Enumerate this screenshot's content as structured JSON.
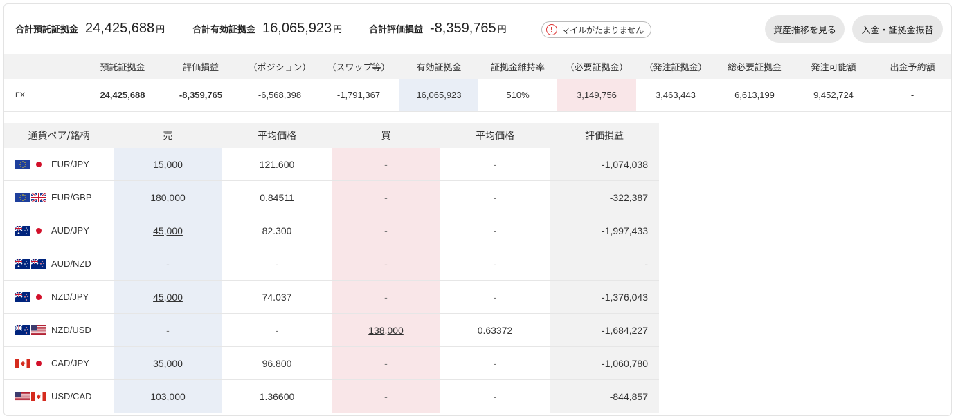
{
  "summary": {
    "deposit": {
      "label": "合計預託証拠金",
      "value": "24,425,688",
      "unit": "円"
    },
    "effective": {
      "label": "合計有効証拠金",
      "value": "16,065,923",
      "unit": "円"
    },
    "pl": {
      "label": "合計評価損益",
      "value": "-8,359,765",
      "unit": "円"
    },
    "mile_badge": "マイルがたまりません",
    "btn_history": "資産推移を見る",
    "btn_transfer": "入金・証拠金振替"
  },
  "margin_table": {
    "headers": [
      "預託証拠金",
      "評価損益",
      "（ポジション）",
      "（スワップ等）",
      "有効証拠金",
      "証拠金維持率",
      "（必要証拠金）",
      "（発注証拠金）",
      "総必要証拠金",
      "発注可能額",
      "出金予約額"
    ],
    "row": {
      "label": "FX",
      "values": [
        "24,425,688",
        "-8,359,765",
        "-6,568,398",
        "-1,791,367",
        "16,065,923",
        "510%",
        "3,149,756",
        "3,463,443",
        "6,613,199",
        "9,452,724",
        "-"
      ]
    }
  },
  "positions": {
    "headers": [
      "通貨ペア/銘柄",
      "売",
      "平均価格",
      "買",
      "平均価格",
      "評価損益"
    ],
    "rows": [
      {
        "pair": "EUR/JPY",
        "flags": [
          "eu",
          "jp"
        ],
        "sell": "15,000",
        "sell_avg": "121.600",
        "buy": "-",
        "buy_avg": "-",
        "pl": "-1,074,038"
      },
      {
        "pair": "EUR/GBP",
        "flags": [
          "eu",
          "gb"
        ],
        "sell": "180,000",
        "sell_avg": "0.84511",
        "buy": "-",
        "buy_avg": "-",
        "pl": "-322,387"
      },
      {
        "pair": "AUD/JPY",
        "flags": [
          "au",
          "jp"
        ],
        "sell": "45,000",
        "sell_avg": "82.300",
        "buy": "-",
        "buy_avg": "-",
        "pl": "-1,997,433"
      },
      {
        "pair": "AUD/NZD",
        "flags": [
          "au",
          "nz"
        ],
        "sell": "-",
        "sell_avg": "-",
        "buy": "-",
        "buy_avg": "-",
        "pl": "-"
      },
      {
        "pair": "NZD/JPY",
        "flags": [
          "nz",
          "jp"
        ],
        "sell": "45,000",
        "sell_avg": "74.037",
        "buy": "-",
        "buy_avg": "-",
        "pl": "-1,376,043"
      },
      {
        "pair": "NZD/USD",
        "flags": [
          "nz",
          "us"
        ],
        "sell": "-",
        "sell_avg": "-",
        "buy": "138,000",
        "buy_avg": "0.63372",
        "pl": "-1,684,227"
      },
      {
        "pair": "CAD/JPY",
        "flags": [
          "ca",
          "jp"
        ],
        "sell": "35,000",
        "sell_avg": "96.800",
        "buy": "-",
        "buy_avg": "-",
        "pl": "-1,060,780"
      },
      {
        "pair": "USD/CAD",
        "flags": [
          "us",
          "ca"
        ],
        "sell": "103,000",
        "sell_avg": "1.36600",
        "buy": "-",
        "buy_avg": "-",
        "pl": "-844,857"
      }
    ]
  },
  "colors": {
    "sell_bg": "#e9eef6",
    "buy_bg": "#f9e6e8",
    "header_bg": "#f2f2f2",
    "alert": "#dd3333"
  }
}
